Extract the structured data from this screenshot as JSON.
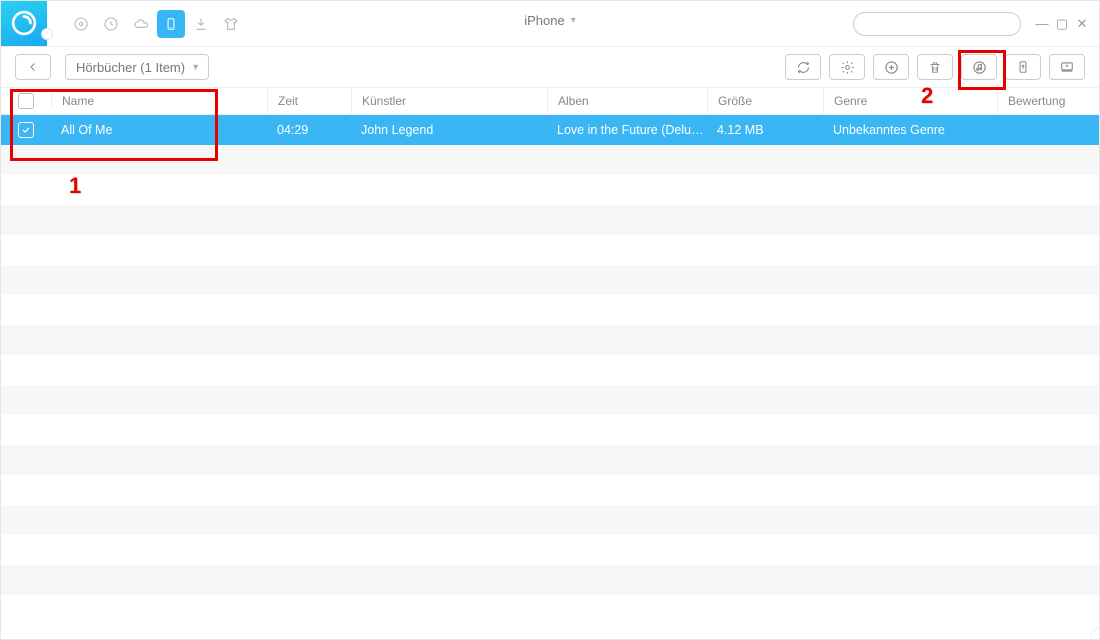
{
  "header": {
    "device_title": "iPhone",
    "search_placeholder": ""
  },
  "breadcrumb": {
    "label": "Hörbücher (1 Item)"
  },
  "columns": {
    "name": "Name",
    "time": "Zeit",
    "artist": "Künstler",
    "album": "Alben",
    "size": "Größe",
    "genre": "Genre",
    "rating": "Bewertung"
  },
  "rows": [
    {
      "selected": true,
      "name": "All Of Me",
      "time": "04:29",
      "artist": "John Legend",
      "album": "Love in the Future (Delux...",
      "size": "4.12 MB",
      "genre": "Unbekanntes Genre",
      "rating": ""
    }
  ],
  "annotations": {
    "label1": "1",
    "label2": "2"
  }
}
